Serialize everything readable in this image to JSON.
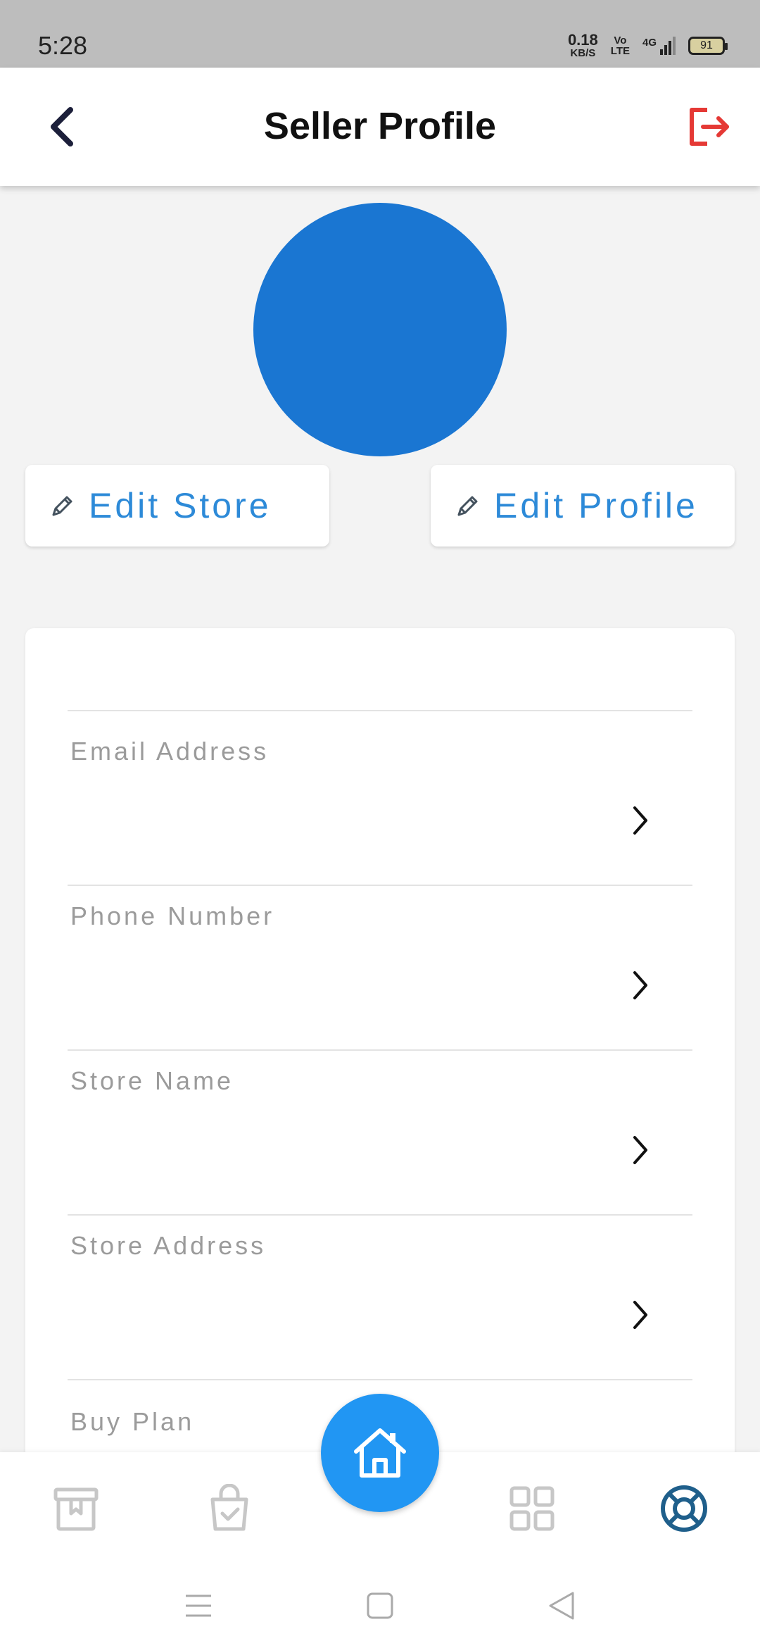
{
  "status_bar": {
    "time": "5:28",
    "net_speed_value": "0.18",
    "net_speed_unit": "KB/S",
    "volte_top": "Vo",
    "volte_bottom": "LTE",
    "network": "4G",
    "battery": "91"
  },
  "header": {
    "title": "Seller Profile",
    "back_icon": "chevron-left-icon",
    "logout_icon": "logout-icon"
  },
  "actions": {
    "edit_store_label": "Edit Store",
    "edit_profile_label": "Edit Profile",
    "edit_icon": "pencil-icon"
  },
  "profile_fields": [
    {
      "label": "Email Address"
    },
    {
      "label": "Phone Number"
    },
    {
      "label": "Store Name"
    },
    {
      "label": "Store Address"
    },
    {
      "label": "Buy Plan"
    }
  ],
  "bottom_nav": {
    "items": [
      "archive-icon",
      "shopping-bag-icon",
      "home-icon",
      "grid-icon",
      "support-icon"
    ],
    "active": "support-icon"
  },
  "colors": {
    "accent": "#2196f3",
    "avatar": "#1a76d2",
    "edit_text": "#2d8ad8",
    "logout": "#e53935",
    "active_nav": "#1f5f8b",
    "inactive_nav": "#c7c7c7"
  }
}
